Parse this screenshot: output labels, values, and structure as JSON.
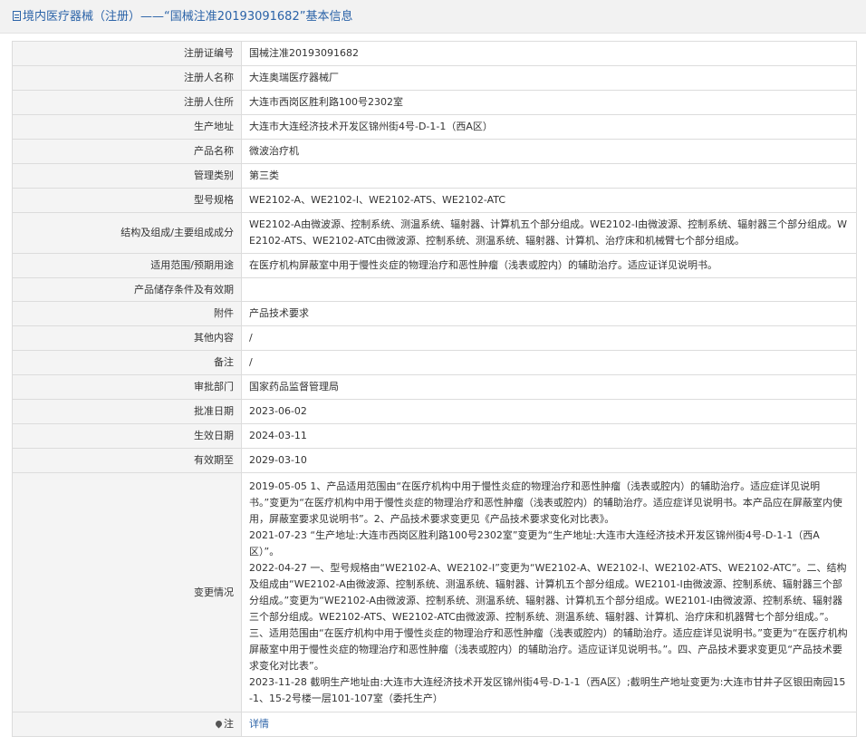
{
  "header": {
    "title": "境内医疗器械（注册）——“国械注准20193091682”基本信息",
    "icon": "document-icon"
  },
  "rows": {
    "reg_no": {
      "label": "注册证编号",
      "value": "国械注准20193091682"
    },
    "registrant": {
      "label": "注册人名称",
      "value": "大连奥瑞医疗器械厂"
    },
    "registrant_address": {
      "label": "注册人住所",
      "value": "大连市西岗区胜利路100号2302室"
    },
    "production_address": {
      "label": "生产地址",
      "value": "大连市大连经济技术开发区锦州街4号-D-1-1（西A区）"
    },
    "product_name": {
      "label": "产品名称",
      "value": "微波治疗机"
    },
    "category": {
      "label": "管理类别",
      "value": "第三类"
    },
    "model": {
      "label": "型号规格",
      "value": "WE2102-A、WE2102-I、WE2102-ATS、WE2102-ATC"
    },
    "structure": {
      "label": "结构及组成/主要组成成分",
      "value": "WE2102-A由微波源、控制系统、测温系统、辐射器、计算机五个部分组成。WE2102-I由微波源、控制系统、辐射器三个部分组成。WE2102-ATS、WE2102-ATC由微波源、控制系统、测温系统、辐射器、计算机、治疗床和机械臂七个部分组成。"
    },
    "scope": {
      "label": "适用范围/预期用途",
      "value": "在医疗机构屏蔽室中用于慢性炎症的物理治疗和恶性肿瘤（浅表或腔内）的辅助治疗。适应证详见说明书。"
    },
    "storage": {
      "label": "产品储存条件及有效期",
      "value": ""
    },
    "attachment": {
      "label": "附件",
      "value": "产品技术要求"
    },
    "other": {
      "label": "其他内容",
      "value": "/"
    },
    "remark": {
      "label": "备注",
      "value": "/"
    },
    "approval_dept": {
      "label": "审批部门",
      "value": "国家药品监督管理局"
    },
    "approval_date": {
      "label": "批准日期",
      "value": "2023-06-02"
    },
    "effective_date": {
      "label": "生效日期",
      "value": "2024-03-11"
    },
    "expiry": {
      "label": "有效期至",
      "value": "2029-03-10"
    },
    "changes": {
      "label": "变更情况",
      "entries": [
        "2019-05-05 1、产品适用范围由“在医疗机构中用于慢性炎症的物理治疗和恶性肿瘤（浅表或腔内）的辅助治疗。适应症详见说明书。”变更为“在医疗机构中用于慢性炎症的物理治疗和恶性肿瘤（浅表或腔内）的辅助治疗。适应症详见说明书。本产品应在屏蔽室内使用，屏蔽室要求见说明书”。2、产品技术要求变更见《产品技术要求变化对比表》。",
        "2021-07-23 “生产地址:大连市西岗区胜利路100号2302室”变更为“生产地址:大连市大连经济技术开发区锦州街4号-D-1-1（西A区）”。",
        "2022-04-27 一、型号规格由“WE2102-A、WE2102-I”变更为“WE2102-A、WE2102-I、WE2102-ATS、WE2102-ATC”。二、结构及组成由“WE2102-A由微波源、控制系统、测温系统、辐射器、计算机五个部分组成。WE2101-I由微波源、控制系统、辐射器三个部分组成。”变更为“WE2102-A由微波源、控制系统、测温系统、辐射器、计算机五个部分组成。WE2101-I由微波源、控制系统、辐射器三个部分组成。WE2102-ATS、WE2102-ATC由微波源、控制系统、测温系统、辐射器、计算机、治疗床和机器臂七个部分组成。”。三、适用范围由“在医疗机构中用于慢性炎症的物理治疗和恶性肿瘤（浅表或腔内）的辅助治疗。适应症详见说明书。”变更为“在医疗机构屏蔽室中用于慢性炎症的物理治疗和恶性肿瘤（浅表或腔内）的辅助治疗。适应证详见说明书。”。四、产品技术要求变更见“产品技术要求变化对比表”。",
        "2023-11-28 截明生产地址由:大连市大连经济技术开发区锦州街4号-D-1-1（西A区）;截明生产地址变更为:大连市甘井子区银田南园15-1、15-2号楼一层101-107室（委托生产）"
      ]
    },
    "note": {
      "label": "注",
      "link": "详情",
      "icon": "pin-icon"
    }
  }
}
